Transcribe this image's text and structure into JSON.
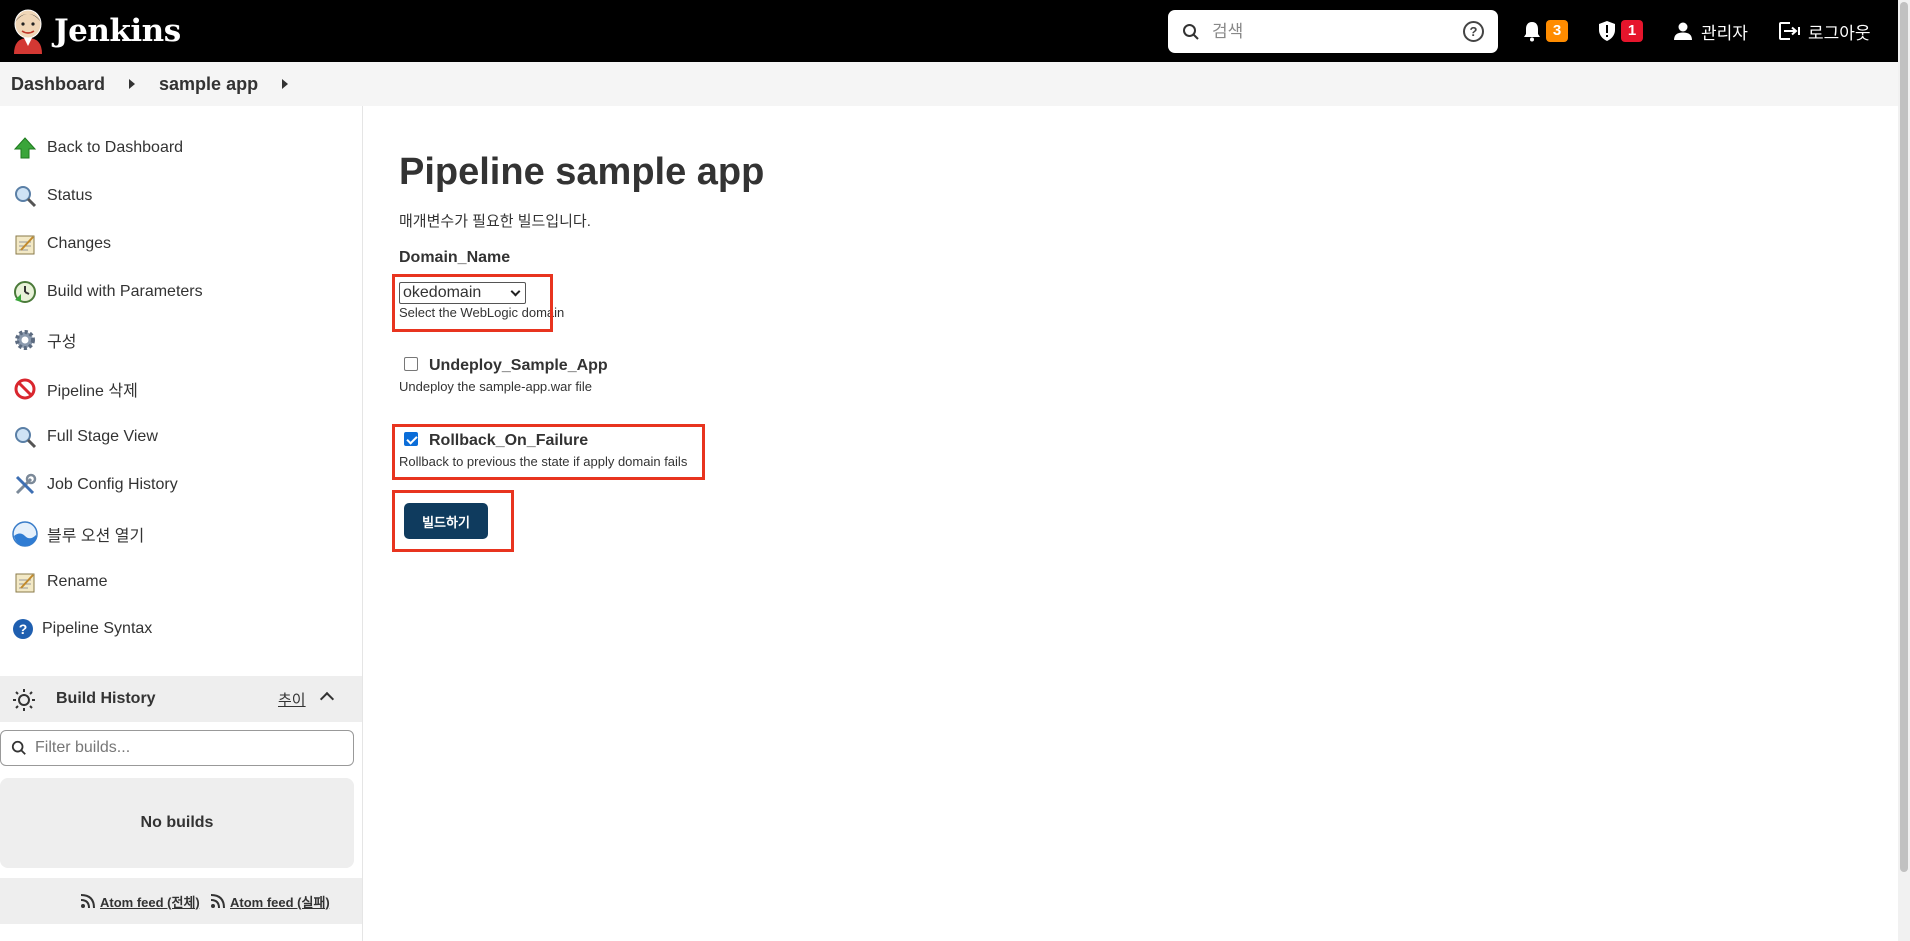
{
  "header": {
    "logo_text": "Jenkins",
    "search_placeholder": "검색",
    "notifications_count": "3",
    "security_count": "1",
    "user_label": "관리자",
    "logout_label": "로그아웃"
  },
  "breadcrumb": {
    "items": [
      "Dashboard",
      "sample app"
    ]
  },
  "sidebar": {
    "items": [
      {
        "label": "Back to Dashboard",
        "icon": "up-arrow-icon"
      },
      {
        "label": "Status",
        "icon": "magnifier-icon"
      },
      {
        "label": "Changes",
        "icon": "notepad-icon"
      },
      {
        "label": "Build with Parameters",
        "icon": "clock-icon"
      },
      {
        "label": "구성",
        "icon": "gear-icon"
      },
      {
        "label": "Pipeline 삭제",
        "icon": "no-entry-icon"
      },
      {
        "label": "Full Stage View",
        "icon": "magnifier-icon"
      },
      {
        "label": "Job Config History",
        "icon": "tools-icon"
      },
      {
        "label": "블루 오션 열기",
        "icon": "blue-ocean-icon"
      },
      {
        "label": "Rename",
        "icon": "notepad-icon"
      },
      {
        "label": "Pipeline Syntax",
        "icon": "help-icon"
      }
    ],
    "build_history": {
      "title": "Build History",
      "trend": "추이",
      "filter_placeholder": "Filter builds...",
      "empty": "No builds"
    },
    "feeds": {
      "all": "Atom feed (전체)",
      "failed": "Atom feed (실패)"
    }
  },
  "main": {
    "title": "Pipeline sample app",
    "description": "매개변수가 필요한 빌드입니다.",
    "params": {
      "domain": {
        "label": "Domain_Name",
        "selected": "okedomain",
        "help": "Select the WebLogic domain"
      },
      "undeploy": {
        "label": "Undeploy_Sample_App",
        "checked": false,
        "help": "Undeploy the sample-app.war file"
      },
      "rollback": {
        "label": "Rollback_On_Failure",
        "checked": true,
        "help": "Rollback to previous the state if apply domain fails"
      }
    },
    "build_button": "빌드하기"
  },
  "colors": {
    "header_bg": "#000000",
    "build_button_bg": "#0f3b5e",
    "highlight_box": "#e8341f",
    "badge_orange": "#ff8c00",
    "badge_red": "#e6152c"
  }
}
